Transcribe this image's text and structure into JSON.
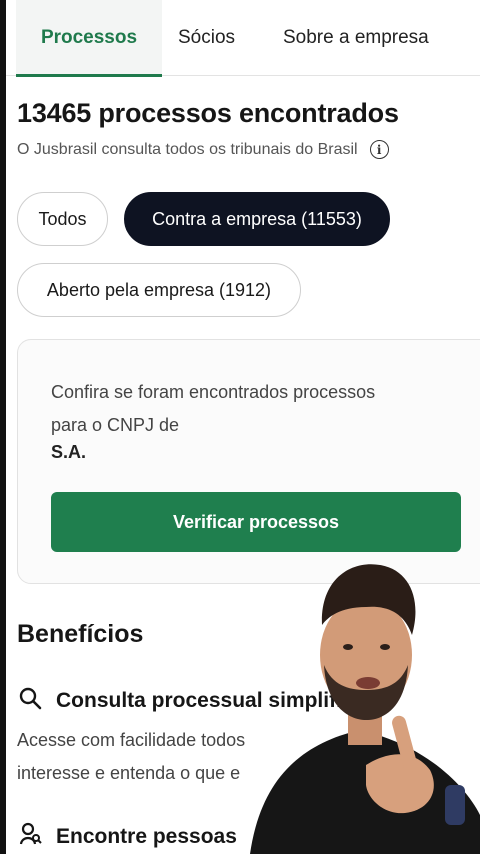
{
  "tabs": [
    {
      "label": "Processos",
      "active": true
    },
    {
      "label": "Sócios",
      "active": false
    },
    {
      "label": "Sobre a empresa",
      "active": false
    }
  ],
  "header": {
    "title": "13465 processos encontrados",
    "subtitle": "O Jusbrasil consulta todos os tribunais do Brasil",
    "info_icon": "i"
  },
  "filters": [
    {
      "label": "Todos",
      "selected": false
    },
    {
      "label": "Contra a empresa (11553)",
      "selected": true
    },
    {
      "label": "Aberto pela empresa (1912)",
      "selected": false
    }
  ],
  "card": {
    "line1": "Confira se foram encontrados processos",
    "line2": "para o CNPJ de",
    "company": "S.A.",
    "button_label": "Verificar processos",
    "button_color": "#1f7f4e"
  },
  "benefits": {
    "heading": "Benefícios",
    "items": [
      {
        "icon": "search-icon",
        "title": "Consulta processual simplifi",
        "desc_line1": "Acesse com facilidade todos",
        "desc_line2": "interesse e entenda o que e"
      },
      {
        "icon": "people-icon",
        "title": "Encontre pessoas"
      }
    ]
  },
  "colors": {
    "accent": "#1f7a4c",
    "chip_selected": "#0e1322"
  }
}
